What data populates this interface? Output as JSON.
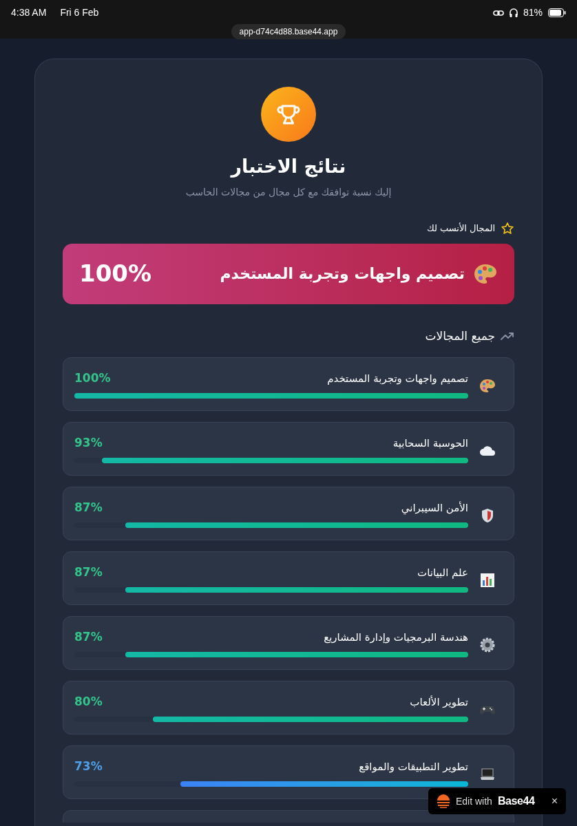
{
  "status_bar": {
    "time": "4:38 AM",
    "date": "Fri 6 Feb",
    "battery": "81%"
  },
  "address_bar": {
    "url": "app-d74c4d88.base44.app"
  },
  "header": {
    "title": "نتائج الاختبار",
    "subtitle": "إليك نسبة توافقك مع كل مجال من مجالات الحاسب"
  },
  "best_match": {
    "label": "المجال الأنسب لك",
    "name": "تصميم واجهات وتجربة المستخدم",
    "percent": "100%"
  },
  "all_fields": {
    "heading": "جميع المجالات",
    "items": [
      {
        "name": "تصميم واجهات وتجربة المستخدم",
        "percent": "100%",
        "level": 1.0
      },
      {
        "name": "الحوسبة السحابية",
        "percent": "93%",
        "level": 0.93
      },
      {
        "name": "الأمن السيبراني",
        "percent": "87%",
        "level": 0.87
      },
      {
        "name": "علم البيانات",
        "percent": "87%",
        "level": 0.87
      },
      {
        "name": "هندسة البرمجيات وإدارة المشاريع",
        "percent": "87%",
        "level": 0.87
      },
      {
        "name": "تطوير الألعاب",
        "percent": "80%",
        "level": 0.8
      },
      {
        "name": "تطوير التطبيقات والمواقع",
        "percent": "73%",
        "level": 0.73
      }
    ]
  },
  "edit_badge": {
    "prefix": "Edit with",
    "brand": "Base44",
    "close": "×"
  }
}
